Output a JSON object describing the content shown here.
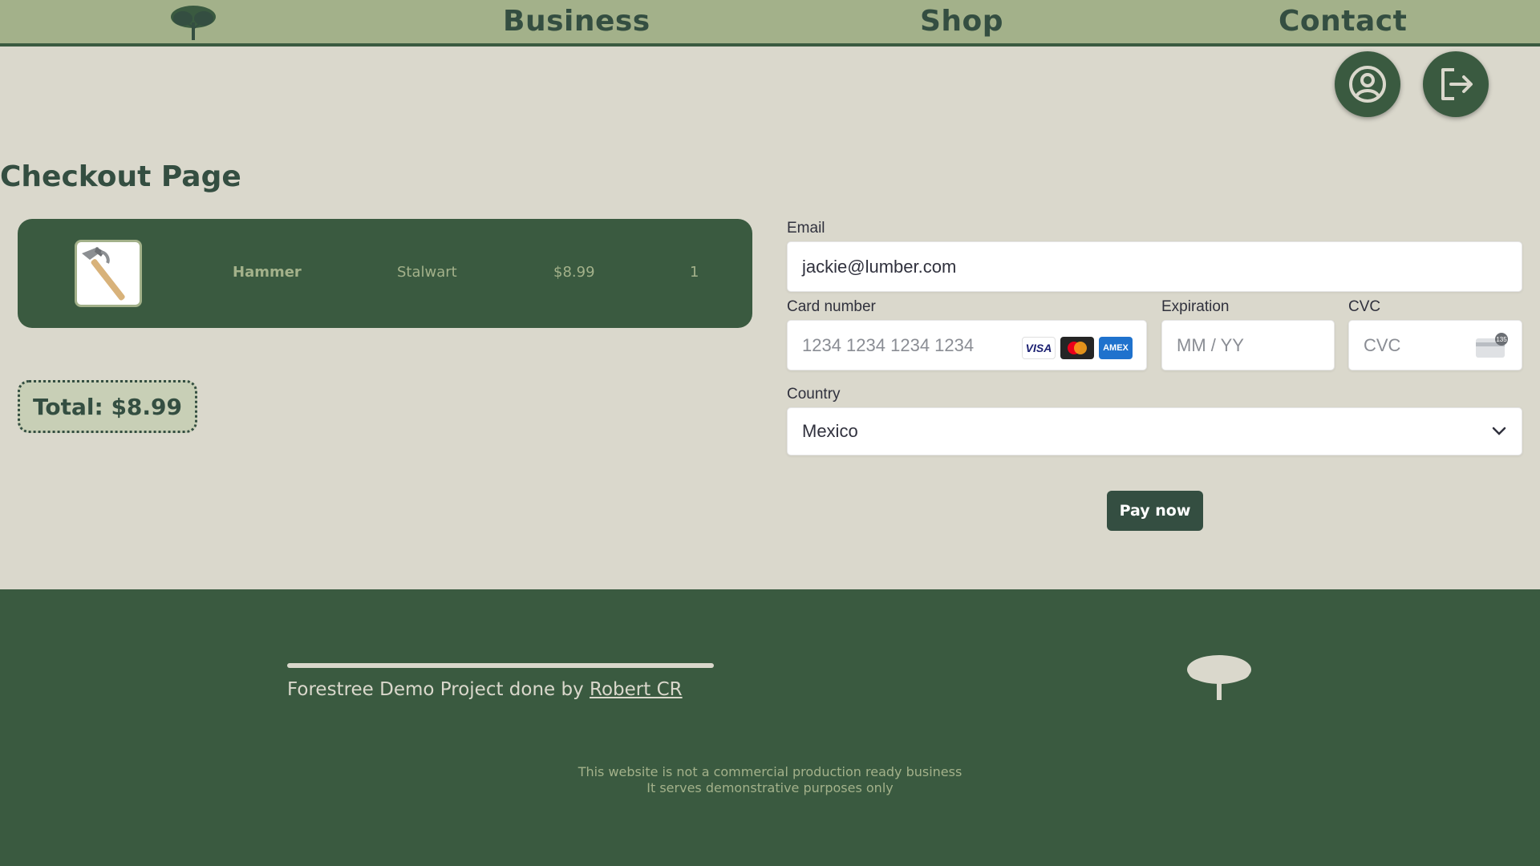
{
  "nav": {
    "logo_icon": "tree-icon",
    "links": [
      "Business",
      "Shop",
      "Contact"
    ]
  },
  "header_actions": {
    "profile_icon": "user-circle-icon",
    "logout_icon": "logout-icon"
  },
  "page": {
    "title": "Checkout Page"
  },
  "cart": {
    "items": [
      {
        "image_icon": "hammer-icon",
        "name": "Hammer",
        "brand": "Stalwart",
        "price": "$8.99",
        "quantity": "1"
      }
    ],
    "total": "Total: $8.99"
  },
  "payment": {
    "email_label": "Email",
    "email_value": "jackie@lumber.com",
    "card_label": "Card number",
    "card_placeholder": "1234 1234 1234 1234",
    "card_brands": [
      "VISA",
      "mastercard",
      "AMEX"
    ],
    "expiry_label": "Expiration",
    "expiry_placeholder": "MM / YY",
    "cvc_label": "CVC",
    "cvc_placeholder": "CVC",
    "cvc_icon_badge": "135",
    "country_label": "Country",
    "country_value": "Mexico",
    "pay_label": "Pay now"
  },
  "footer": {
    "credit_prefix": "Forestree Demo Project done by",
    "credit_link": "Robert CR",
    "disclaimer_line1": "This website is not a commercial production ready business",
    "disclaimer_line2": "It serves demonstrative purposes only",
    "logo_icon": "tree-icon"
  },
  "colors": {
    "nav_bg": "#a3b18a",
    "page_bg": "#dad8cc",
    "primary": "#3a5a40",
    "dark": "#344e41"
  }
}
